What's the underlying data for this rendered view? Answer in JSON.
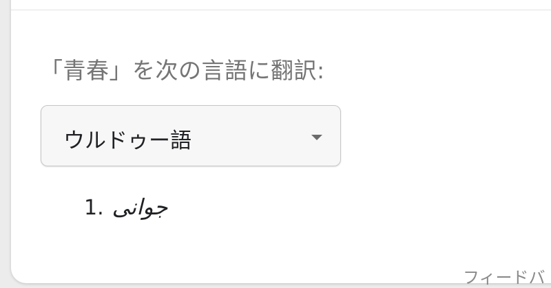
{
  "translator": {
    "prompt": "「青春」を次の言語に翻訳:",
    "language_select": {
      "value": "ウルドゥー語"
    },
    "results": [
      {
        "number": "1.",
        "text": "جوانی"
      }
    ],
    "feedback_label": "フィードバ"
  },
  "colors": {
    "prompt_text": "#757575",
    "select_bg": "#f7f7f7",
    "select_border": "#c6c6c6",
    "primary_text": "#202124"
  },
  "icons": {
    "dropdown": "caret-down-icon"
  }
}
